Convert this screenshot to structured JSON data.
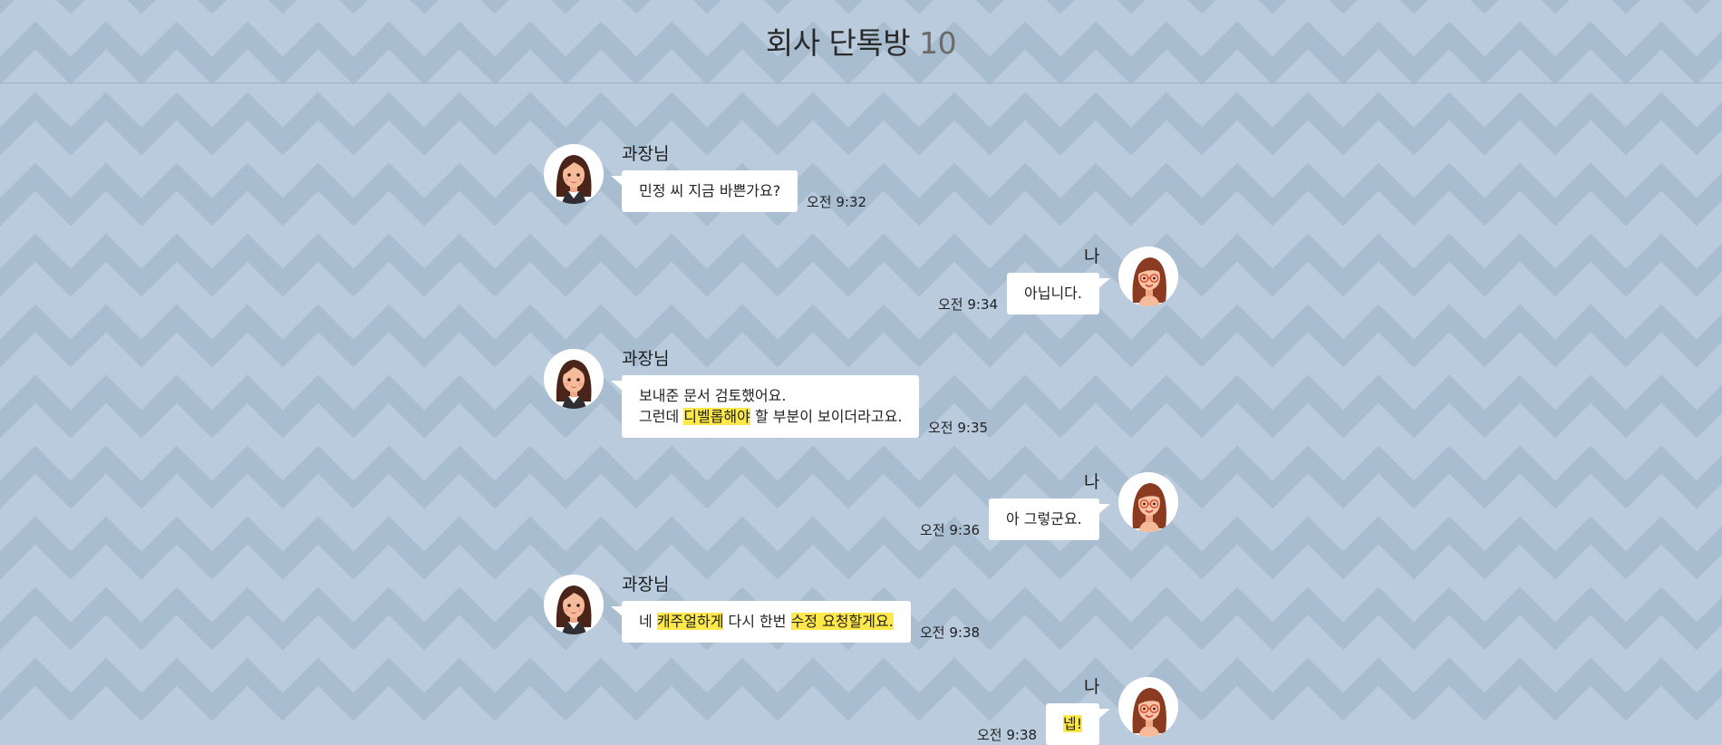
{
  "room": {
    "title": "회사 단톡방",
    "member_count": "10"
  },
  "colors": {
    "background": "#b9cbdc",
    "pattern": "#a9bdd1",
    "bubble": "#ffffff",
    "highlight": "#ffe94a"
  },
  "icons": {
    "sender_avatar": "woman-avatar-icon",
    "self_avatar": "woman-with-glasses-avatar-icon"
  },
  "messages": [
    {
      "sender": "과장님",
      "side": "left",
      "lines": [
        [
          {
            "text": "민정 씨 지금 바쁜가요?"
          }
        ]
      ],
      "time": "오전 9:32"
    },
    {
      "sender": "나",
      "side": "right",
      "lines": [
        [
          {
            "text": "아닙니다."
          }
        ]
      ],
      "time": "오전 9:34"
    },
    {
      "sender": "과장님",
      "side": "left",
      "lines": [
        [
          {
            "text": "보내준 문서 검토했어요."
          }
        ],
        [
          {
            "text": "그런데 "
          },
          {
            "text": "디벨롭해야",
            "highlight": true
          },
          {
            "text": " 할 부분이 보이더라고요."
          }
        ]
      ],
      "time": "오전 9:35"
    },
    {
      "sender": "나",
      "side": "right",
      "lines": [
        [
          {
            "text": "아 그렇군요."
          }
        ]
      ],
      "time": "오전 9:36"
    },
    {
      "sender": "과장님",
      "side": "left",
      "lines": [
        [
          {
            "text": "네 "
          },
          {
            "text": "캐주얼하게",
            "highlight": true
          },
          {
            "text": " 다시 한번 "
          },
          {
            "text": "수정 요청할게요.",
            "highlight": true
          }
        ]
      ],
      "time": "오전 9:38"
    },
    {
      "sender": "나",
      "side": "right",
      "lines": [
        [
          {
            "text": "넵!",
            "highlight": true
          }
        ]
      ],
      "time": "오전 9:38"
    }
  ]
}
